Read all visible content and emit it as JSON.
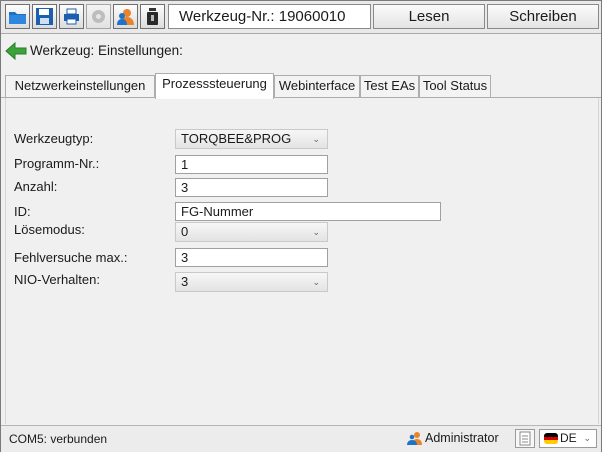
{
  "toolbar": {
    "tool_number": "Werkzeug-Nr.: 19060010",
    "read_button": "Lesen",
    "write_button": "Schreiben",
    "icons": [
      "open-folder-icon",
      "save-icon",
      "printer-icon",
      "settings-gear-icon",
      "user-icon",
      "tool-icon"
    ]
  },
  "header": {
    "back_icon": "back-arrow-icon",
    "title": "Werkzeug: Einstellungen:"
  },
  "tabs": [
    {
      "label": "Netzwerkeinstellungen",
      "active": false
    },
    {
      "label": "Prozesssteuerung",
      "active": true
    },
    {
      "label": "Webinterface",
      "active": false
    },
    {
      "label": "Test EAs",
      "active": false
    },
    {
      "label": "Tool Status",
      "active": false
    }
  ],
  "form": {
    "werkzeugtyp": {
      "label": "Werkzeugtyp:",
      "value": "TORQBEE&PROG"
    },
    "programm_nr": {
      "label": "Programm-Nr.:",
      "value": "1"
    },
    "anzahl": {
      "label": "Anzahl:",
      "value": "3"
    },
    "id": {
      "label": "ID:",
      "value": "FG-Nummer"
    },
    "loesemodus": {
      "label": "Lösemodus:",
      "value": "0"
    },
    "fehlversuche": {
      "label": "Fehlversuche max.:",
      "value": "3"
    },
    "nio_verhalten": {
      "label": "NIO-Verhalten:",
      "value": "3"
    }
  },
  "status": {
    "connection": "COM5: verbunden",
    "user": "Administrator",
    "language": "DE"
  },
  "colors": {
    "accent_blue": "#1e73c8",
    "user_orange": "#e9842a",
    "back_green": "#3aa33a"
  }
}
